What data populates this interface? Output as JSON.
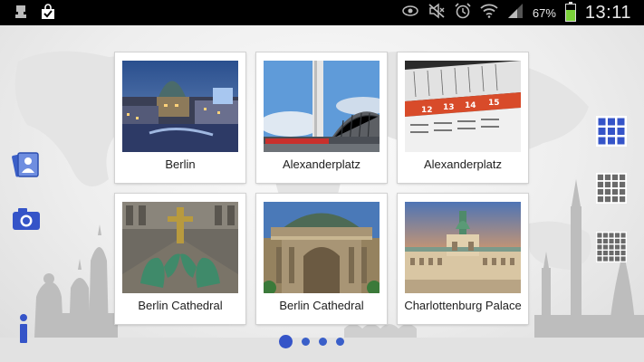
{
  "status_bar": {
    "battery": "67%",
    "battery_level": 0.67,
    "time": "13:11",
    "left_icons": [
      "usb-debug-icon",
      "shopping-bag-check-icon"
    ],
    "right_icons": [
      "eye-icon",
      "mute-icon",
      "alarm-icon",
      "wifi-icon",
      "signal-icon",
      "battery-icon"
    ]
  },
  "tiles": [
    {
      "label": "Berlin"
    },
    {
      "label": "Alexanderplatz"
    },
    {
      "label": "Alexanderplatz"
    },
    {
      "label": "Berlin Cathedral"
    },
    {
      "label": "Berlin Cathedral"
    },
    {
      "label": "Charlottenburg Palace"
    }
  ],
  "left_actions": [
    "contacts-card-icon",
    "camera-icon",
    "info-icon"
  ],
  "view_modes": [
    "grid-3x3-icon",
    "grid-4x4-icon",
    "grid-5x5-icon"
  ],
  "pager": {
    "pages": 4,
    "current": 1
  },
  "colors": {
    "accent": "#3554c8",
    "status_bar": "#000000",
    "tile_bg": "#ffffff",
    "label_text": "#202020"
  }
}
